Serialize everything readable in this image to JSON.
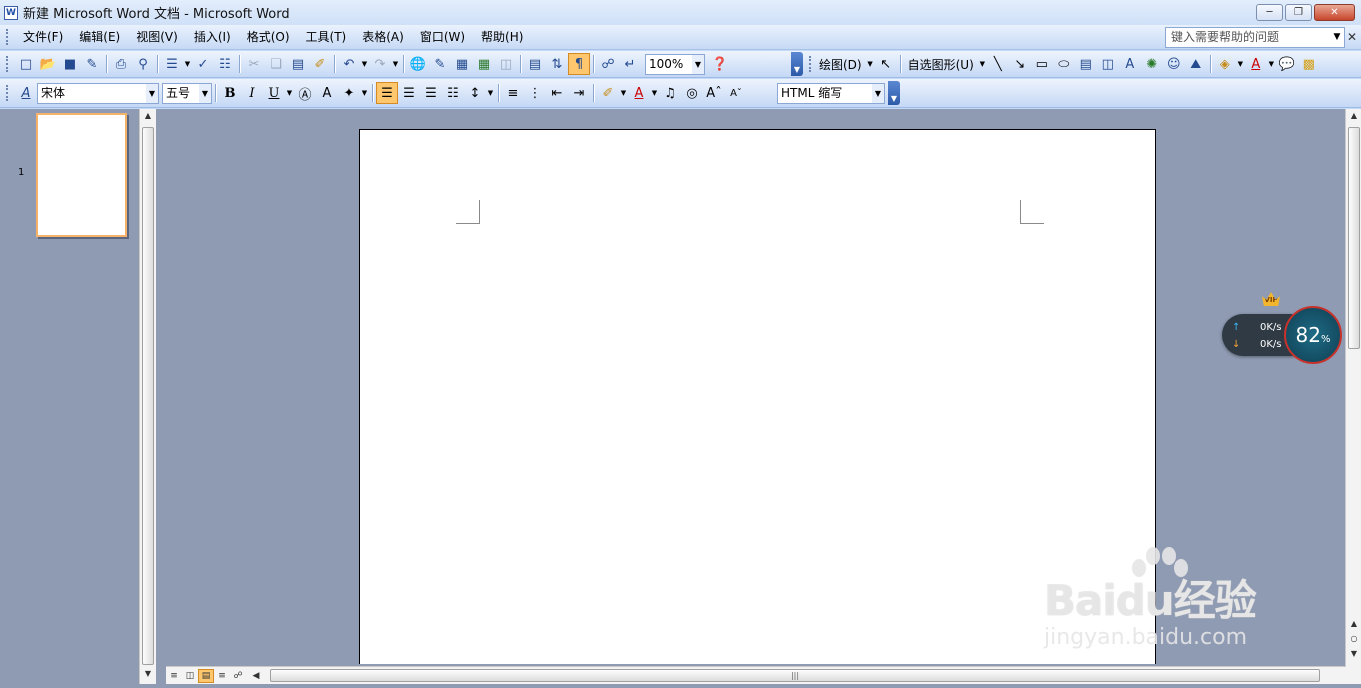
{
  "window": {
    "title": "新建 Microsoft Word 文档 - Microsoft Word",
    "app_icon": "W"
  },
  "menu": {
    "items": [
      "文件(F)",
      "编辑(E)",
      "视图(V)",
      "插入(I)",
      "格式(O)",
      "工具(T)",
      "表格(A)",
      "窗口(W)",
      "帮助(H)"
    ],
    "help_placeholder": "键入需要帮助的问题"
  },
  "standard_toolbar": {
    "zoom": "100%"
  },
  "drawing_toolbar": {
    "draw_label": "绘图(D)",
    "autoshapes_label": "自选图形(U)"
  },
  "formatting_toolbar": {
    "style_glyph": "A",
    "font": "宋体",
    "size": "五号",
    "style": "HTML 缩写"
  },
  "thumbnails": {
    "page_number": "1"
  },
  "network_monitor": {
    "upload": "0K/s",
    "download": "0K/s",
    "percent": "82",
    "percent_sign": "%",
    "badge": "VIP"
  },
  "watermark": {
    "brand": "Baidu经验",
    "url": "jingyan.baidu.com"
  }
}
